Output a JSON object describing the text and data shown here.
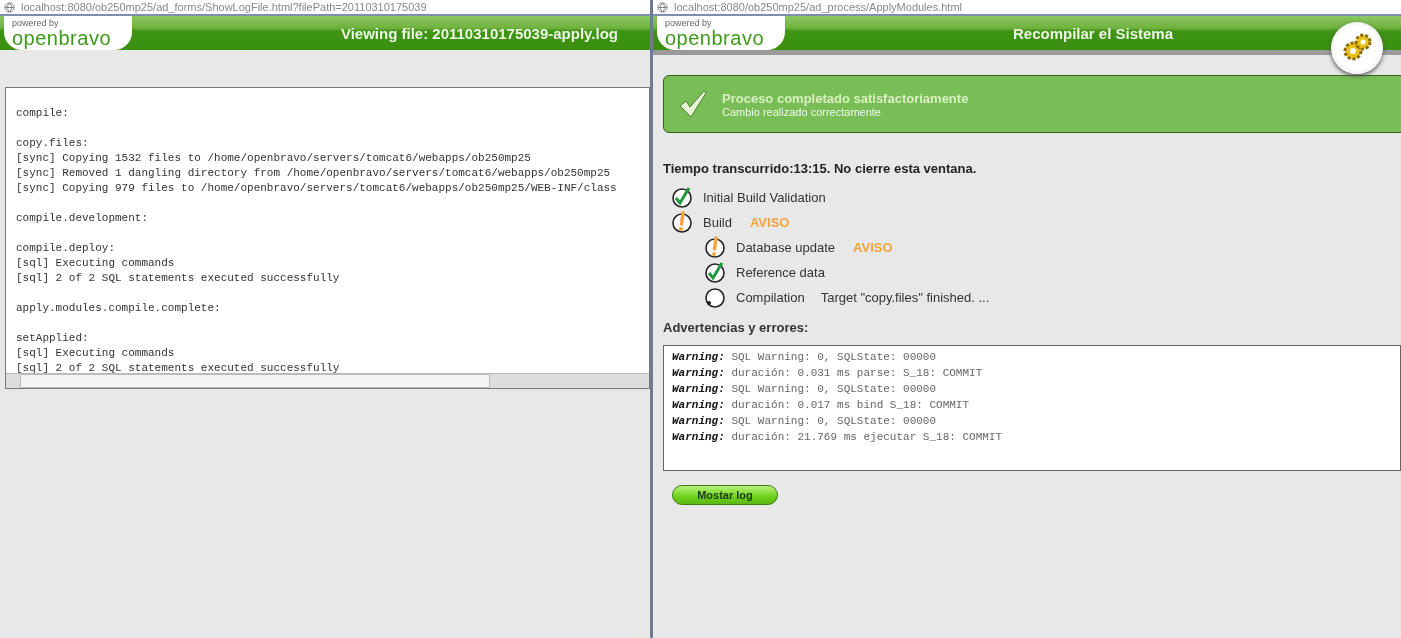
{
  "left_window": {
    "url": "localhost:8080/ob250mp25/ad_forms/ShowLogFile.html?filePath=20110310175039",
    "logo": {
      "tagline": "powered by",
      "name": "openbravo"
    },
    "title": "Viewing file: 20110310175039-apply.log",
    "log_blocks": [
      [
        "compile:"
      ],
      [
        "copy.files:",
        "[sync] Copying 1532 files to /home/openbravo/servers/tomcat6/webapps/ob250mp25",
        "[sync] Removed 1 dangling directory from /home/openbravo/servers/tomcat6/webapps/ob250mp25",
        "[sync] Copying 979 files to /home/openbravo/servers/tomcat6/webapps/ob250mp25/WEB-INF/class"
      ],
      [
        "compile.development:"
      ],
      [
        "compile.deploy:",
        "[sql] Executing commands",
        "[sql] 2 of 2 SQL statements executed successfully"
      ],
      [
        "apply.modules.compile.complete:"
      ],
      [
        "setApplied:",
        "[sql] Executing commands",
        "[sql] 2 of 2 SQL statements executed successfully"
      ]
    ]
  },
  "right_window": {
    "url": "localhost:8080/ob250mp25/ad_process/ApplyModules.html",
    "logo": {
      "tagline": "powered by",
      "name": "openbravo"
    },
    "title": "Recompilar el Sistema",
    "message": {
      "kind": "success",
      "title": "Proceso completado satisfactoriamente",
      "text": "Cambio realizado correctamente"
    },
    "elapsed": "Tiempo transcurrido:13:15. No cierre esta ventana.",
    "steps": [
      {
        "label": "Initial Build Validation",
        "kind": "ok"
      },
      {
        "label": "Build",
        "kind": "warning",
        "badge": "AVISO",
        "children": [
          {
            "label": "Database update",
            "kind": "warning",
            "badge": "AVISO"
          },
          {
            "label": "Reference data",
            "kind": "ok"
          },
          {
            "label": "Compilation",
            "kind": "running",
            "detail": "Target \"copy.files\" finished. ..."
          }
        ]
      }
    ],
    "warnings_title": "Advertencias y errores:",
    "warnings": [
      {
        "label": "Warning:",
        "text": "SQL Warning: 0, SQLState: 00000"
      },
      {
        "label": "Warning:",
        "text": "duración: 0.031 ms parse: S_18: COMMIT"
      },
      {
        "label": "Warning:",
        "text": "SQL Warning: 0, SQLState: 00000"
      },
      {
        "label": "Warning:",
        "text": "duración: 0.017 ms bind S_18: COMMIT"
      },
      {
        "label": "Warning:",
        "text": "SQL Warning: 0, SQLState: 00000"
      },
      {
        "label": "Warning:",
        "text": "duración: 21.769 ms ejecutar S_18: COMMIT"
      }
    ],
    "button": "Mostar log"
  }
}
